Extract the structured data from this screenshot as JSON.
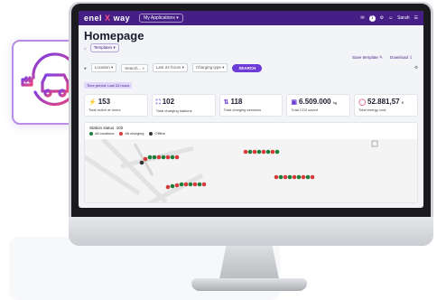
{
  "app": {
    "brand_left": "enel",
    "brand_x": "X",
    "brand_right": "way",
    "apps_label": "My Applications",
    "notifications_count": "1",
    "user_name": "Sarah"
  },
  "page": {
    "title": "Homepage",
    "tabs": [
      "Templates"
    ],
    "save_template": "Save template",
    "download": "Download"
  },
  "filters": {
    "location_label": "Location",
    "search_placeholder": "Search...",
    "period": "Last 24 hours",
    "charging_type": "Charging type",
    "search_button": "SEARCH",
    "period_tag": "Time period: Last 24 hours"
  },
  "kpis": [
    {
      "icon": "charging-point-icon",
      "value": "153",
      "unit": "",
      "label": "Total active at hours"
    },
    {
      "icon": "charging-station-icon",
      "value": "102",
      "unit": "",
      "label": "Total charging stations"
    },
    {
      "icon": "sessions-icon",
      "value": "118",
      "unit": "",
      "label": "Total charging sessions"
    },
    {
      "icon": "battery-icon",
      "value": "6.509.000",
      "unit": "kg",
      "label": "Total CO2 saved"
    },
    {
      "icon": "cost-icon",
      "value": "52.881,57",
      "unit": "€",
      "label": "Total energy cost"
    }
  ],
  "station_status": {
    "title": "Station status",
    "count_label": "102",
    "legend": [
      {
        "label": "All locations",
        "color": "#1e7d3a"
      },
      {
        "label": "Alt charging",
        "color": "#d63a3a"
      },
      {
        "label": "Offline",
        "color": "#333333"
      }
    ]
  },
  "colors": {
    "brand_purple": "#451e86",
    "accent": "#6c3bd8",
    "available": "#1e7d3a",
    "charging": "#d63a3a",
    "icon_card_border": "#b78be6"
  }
}
